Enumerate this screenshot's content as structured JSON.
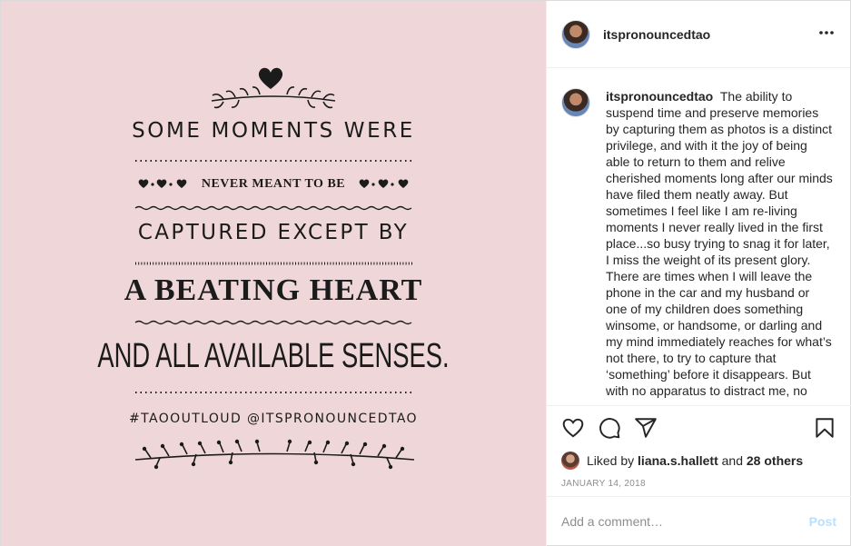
{
  "image": {
    "background_color": "#efd7d9",
    "quote": {
      "line1": "SOME MOMENTS WERE",
      "line2": "NEVER MEANT TO BE",
      "line3": "CAPTURED EXCEPT BY",
      "line4": "A BEATING HEART",
      "line5": "AND ALL AVAILABLE SENSES.",
      "hashtag": "#TAOOUTLOUD @ITSPRONOUNCEDTAO"
    }
  },
  "header": {
    "username": "itspronouncedtao",
    "more_icon": "more-horizontal-icon"
  },
  "caption": {
    "username": "itspronouncedtao",
    "text": "The ability to suspend time and preserve memories by capturing them as photos is a distinct privilege, and with it the joy of being able to return to them and relive cherished moments long after our minds have filed them neatly away. But sometimes I feel like I am re-living moments I never really lived in the first place...so busy trying to snag it for later, I miss the weight of its present glory. There are times when I will leave the phone in the car and my husband or one of my children does something winsome, or handsome, or darling and my mind immediately reaches for what’s not there, to try to capture that ‘something’ before it disappears. But with no apparatus to distract me, no"
  },
  "actions": {
    "icons": [
      "heart-icon",
      "comment-icon",
      "share-icon",
      "bookmark-icon"
    ],
    "liked_prefix": "Liked by",
    "liked_user": "liana.s.hallett",
    "liked_and": "and",
    "liked_others": "28 others",
    "date": "JANUARY 14, 2018"
  },
  "comment_box": {
    "placeholder": "Add a comment…",
    "post_label": "Post"
  },
  "colors": {
    "text": "#262626",
    "muted": "#8e8e8e",
    "post_disabled": "#b9dffc",
    "divider": "#efefef"
  }
}
